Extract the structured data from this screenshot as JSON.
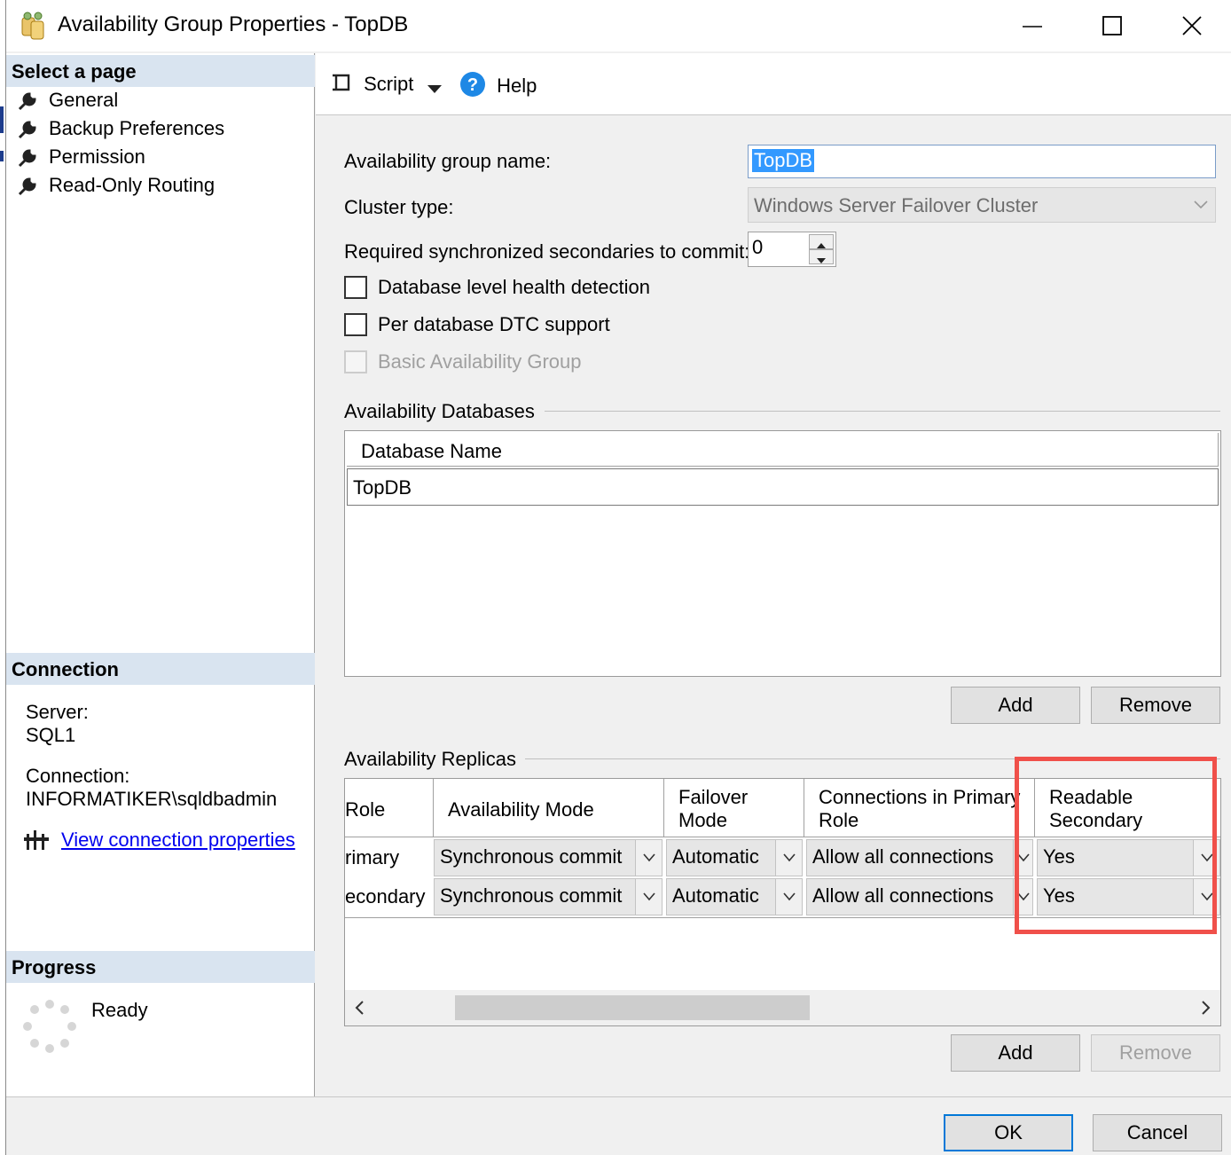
{
  "window": {
    "title": "Availability Group Properties - TopDB",
    "minimize_icon": "minimize-icon",
    "maximize_icon": "maximize-icon",
    "close_icon": "close-icon"
  },
  "sidebar": {
    "select_page_header": "Select a page",
    "pages": [
      {
        "label": "General",
        "icon": "wrench-icon"
      },
      {
        "label": "Backup Preferences",
        "icon": "wrench-icon"
      },
      {
        "label": "Permission",
        "icon": "wrench-icon"
      },
      {
        "label": "Read-Only Routing",
        "icon": "wrench-icon"
      }
    ],
    "connection_header": "Connection",
    "server_label": "Server:",
    "server_value": "SQL1",
    "connection_label": "Connection:",
    "connection_value": "INFORMATIKER\\sqldbadmin",
    "view_connection_link": "View connection properties",
    "progress_header": "Progress",
    "progress_status": "Ready"
  },
  "toolbar": {
    "script_label": "Script",
    "help_label": "Help"
  },
  "general": {
    "ag_name_label": "Availability group name:",
    "ag_name_value": "TopDB",
    "cluster_type_label": "Cluster type:",
    "cluster_type_value": "Windows Server Failover Cluster",
    "required_sync_label": "Required synchronized secondaries to commit:",
    "required_sync_value": "0",
    "db_health_label": "Database level health detection",
    "dtc_label": "Per database DTC support",
    "basic_ag_label": "Basic Availability Group"
  },
  "databases": {
    "group_title": "Availability Databases",
    "column_header": "Database Name",
    "rows": [
      "TopDB"
    ],
    "add_label": "Add",
    "remove_label": "Remove"
  },
  "replicas": {
    "group_title": "Availability Replicas",
    "headers": {
      "role": "Role",
      "availability_mode": "Availability Mode",
      "failover_mode_1": "Failover",
      "failover_mode_2": "Mode",
      "connections_primary_1": "Connections in Primary",
      "connections_primary_2": "Role",
      "readable_secondary_1": "Readable",
      "readable_secondary_2": "Secondary"
    },
    "rows": [
      {
        "role": "rimary",
        "availability_mode": "Synchronous commit",
        "failover_mode": "Automatic",
        "connections_primary": "Allow all connections",
        "readable_secondary": "Yes"
      },
      {
        "role": "econdary",
        "availability_mode": "Synchronous commit",
        "failover_mode": "Automatic",
        "connections_primary": "Allow all connections",
        "readable_secondary": "Yes"
      }
    ],
    "add_label": "Add",
    "remove_label": "Remove",
    "highlight_color": "#f0504a"
  },
  "dialog": {
    "ok_label": "OK",
    "cancel_label": "Cancel"
  }
}
